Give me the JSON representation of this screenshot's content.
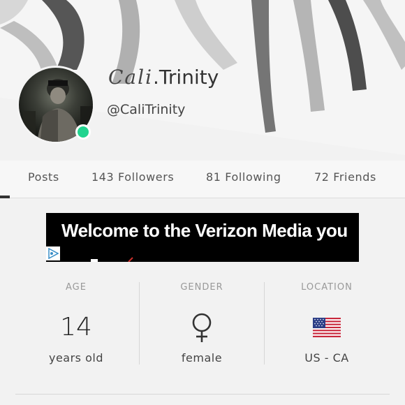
{
  "profile": {
    "display_name_script": "Cali",
    "display_name_suffix": ".Trinity",
    "handle": "@CaliTrinity",
    "online_status_color": "#21d48f"
  },
  "tabs": [
    {
      "label": "Posts"
    },
    {
      "label": "143 Followers"
    },
    {
      "label": "81 Following"
    },
    {
      "label": "72 Friends"
    }
  ],
  "ad": {
    "text": "Welcome to the Verizon Media you",
    "badge_icon": "adchoices-icon"
  },
  "stats": {
    "age": {
      "label": "AGE",
      "value": "14",
      "sub": "years old"
    },
    "gender": {
      "label": "GENDER",
      "icon": "female-symbol-icon",
      "sub": "female"
    },
    "location": {
      "label": "LOCATION",
      "icon": "us-flag-icon",
      "sub": "US - CA"
    }
  }
}
